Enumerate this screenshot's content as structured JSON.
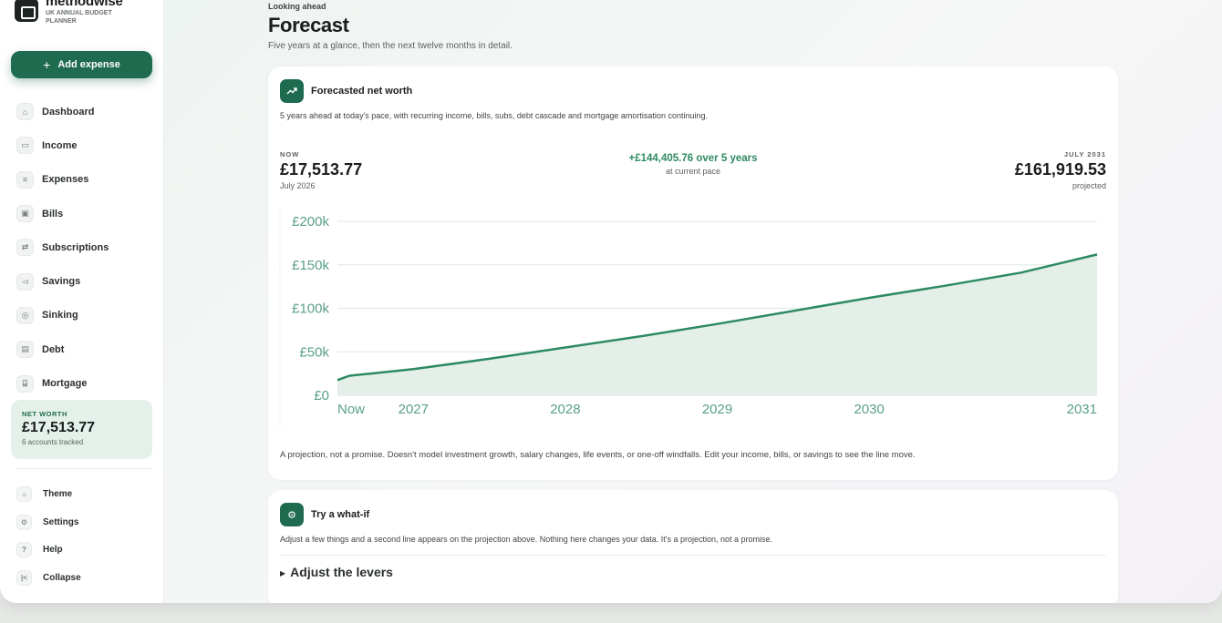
{
  "brand": {
    "name": "methodwise",
    "subtitle": "UK ANNUAL BUDGET PLANNER"
  },
  "sidebar": {
    "add_expense_label": "Add expense",
    "nav": [
      {
        "label": "Dashboard",
        "icon": "home-icon"
      },
      {
        "label": "Income",
        "icon": "cash-icon"
      },
      {
        "label": "Expenses",
        "icon": "receipt-icon"
      },
      {
        "label": "Bills",
        "icon": "calendar-icon"
      },
      {
        "label": "Subscriptions",
        "icon": "repeat-icon"
      },
      {
        "label": "Savings",
        "icon": "piggy-bank-icon"
      },
      {
        "label": "Sinking",
        "icon": "target-icon"
      },
      {
        "label": "Debt",
        "icon": "credit-card-icon"
      },
      {
        "label": "Mortgage",
        "icon": "bank-icon"
      }
    ],
    "net_worth": {
      "label": "NET WORTH",
      "value": "£17,513.77",
      "sub": "6 accounts tracked"
    },
    "utility": [
      {
        "label": "Theme",
        "icon": "sun-icon"
      },
      {
        "label": "Settings",
        "icon": "gear-icon"
      },
      {
        "label": "Help",
        "icon": "help-icon"
      },
      {
        "label": "Collapse",
        "icon": "collapse-icon"
      }
    ]
  },
  "page": {
    "eyebrow": "Looking ahead",
    "title": "Forecast",
    "subtitle": "Five years at a glance, then the next twelve months in detail."
  },
  "net_worth_card": {
    "title": "Forecasted net worth",
    "description": "5 years ahead at today's pace, with recurring income, bills, subs, debt cascade and mortgage amortisation continuing.",
    "now": {
      "label": "NOW",
      "value": "£17,513.77",
      "sub": "July 2026"
    },
    "delta": {
      "value": "+£144,405.76 over 5 years",
      "sub": "at current pace"
    },
    "end": {
      "label": "JULY 2031",
      "value": "£161,919.53",
      "sub": "projected"
    },
    "caption": "A projection, not a promise. Doesn't model investment growth, salary changes, life events, or one-off windfalls. Edit your income, bills, or savings to see the line move."
  },
  "what_if_card": {
    "title": "Try a what-if",
    "description": "Adjust a few things and a second line appears on the projection above. Nothing here changes your data. It's a projection, not a promise.",
    "levers_label": "Adjust the levers"
  },
  "colors": {
    "accent": "#1f6b50",
    "line": "#2e8a63",
    "area": "#e4efe9",
    "axis_text": "#5aa084"
  },
  "chart_data": {
    "type": "area",
    "x": [
      "Now",
      "2027",
      "2028",
      "2029",
      "2030",
      "2031"
    ],
    "x_ticks": [
      "Now",
      "2027",
      "2028",
      "2029",
      "2030",
      "2031"
    ],
    "y_ticks": [
      "£0",
      "£50k",
      "£100k",
      "£150k",
      "£200k"
    ],
    "ylim": [
      0,
      200000
    ],
    "series": [
      {
        "values_x_years": [
          2026.5,
          2026.58,
          2026.75,
          2027.0,
          2027.5,
          2028.0,
          2028.5,
          2029.0,
          2029.5,
          2030.0,
          2030.5,
          2031.0,
          2031.5
        ],
        "values": [
          17514,
          22500,
          25500,
          30000,
          42000,
          55000,
          68000,
          82000,
          97000,
          112000,
          126000,
          141000,
          161920
        ]
      }
    ],
    "grid": true
  }
}
